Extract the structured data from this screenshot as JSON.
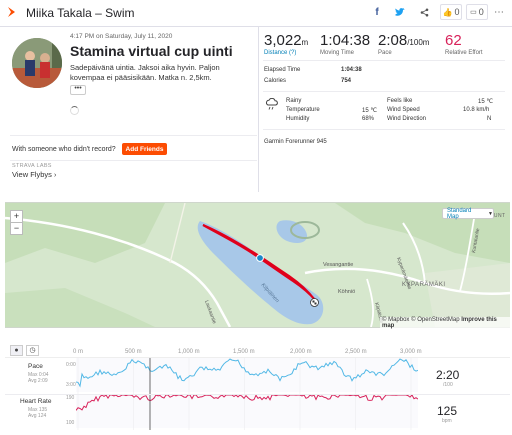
{
  "header": {
    "title": "Miika Takala – Swim",
    "kudos_count": "0",
    "comment_count": "0",
    "share_buttons": [
      "facebook-icon",
      "twitter-icon",
      "share-icon"
    ]
  },
  "activity": {
    "date": "4:17 PM on Saturday, July 11, 2020",
    "name": "Stamina virtual cup uinti",
    "description": "Sadepäivänä uintia. Jaksoi aika hyvin. Paljon kovempaa ei pääsisikään. Matka n. 2,5km.",
    "more_label": "•••"
  },
  "left_footer": {
    "no_record_text": "With someone who didn't record?",
    "add_friends_label": "Add Friends",
    "labs_label": "STRAVA LABS",
    "flyby_label": "View Flybys"
  },
  "stats": {
    "distance": {
      "value": "3,022",
      "unit": "m",
      "label": "Distance (?)"
    },
    "moving_time": {
      "value": "1:04:38",
      "label": "Moving Time"
    },
    "pace": {
      "value": "2:08",
      "unit": "/100m",
      "label": "Pace"
    },
    "relative_effort": {
      "value": "62",
      "label": "Relative Effort"
    },
    "elapsed_time": {
      "label": "Elapsed Time",
      "value": "1:04:38"
    },
    "calories": {
      "label": "Calories",
      "value": "754"
    }
  },
  "weather": {
    "condition": "Rainy",
    "temperature": {
      "label": "Temperature",
      "value": "15 ℃"
    },
    "humidity": {
      "label": "Humidity",
      "value": "68%"
    },
    "feels_like": {
      "label": "Feels like",
      "value": "15 ℃"
    },
    "wind_speed": {
      "label": "Wind Speed",
      "value": "10.8 km/h"
    },
    "wind_direction": {
      "label": "Wind Direction",
      "value": "N"
    }
  },
  "device": "Garmin Forerunner 945",
  "map": {
    "zoom_in": "+",
    "zoom_out": "−",
    "map_type": "Standard Map",
    "attribution": "© Mapbox © OpenStreetMap",
    "improve": "Improve this map",
    "labels": {
      "lake": "Kilpiäinen",
      "vesanpaju": "Vesangantie",
      "kohmio": "Köhniö",
      "kyparamaki": "KYPARÄMÄKI",
      "kyparamaentie": "Kyparämäentie",
      "kuntalantie": "Kuntalanlie",
      "kilpiaistie": "Kilpiäistie",
      "laukaantie": "Laukaantie",
      "kuntaksi": "KUNT"
    },
    "colors": {
      "route": "#e0001b",
      "water": "#a8c8e8",
      "land": "#d6e7cd"
    }
  },
  "chart": {
    "x_ticks": [
      "0 m",
      "500 m",
      "1,000 m",
      "1,500 m",
      "2,000 m",
      "2,500 m",
      "3,000 m"
    ],
    "pace": {
      "label": "Pace",
      "max": "Max 0:04",
      "avg": "Avg 2:09",
      "value": "2:20",
      "unit": "/100",
      "y_top_label": "0:00",
      "y_bottom_label": "3:00",
      "color": "#52b8e6"
    },
    "heart_rate": {
      "label": "Heart Rate",
      "max": "Max 135",
      "avg": "Avg 124",
      "value": "125",
      "unit": "bpm",
      "y_top_label": "190",
      "y_bottom_label": "100",
      "color": "#d8225a"
    }
  }
}
